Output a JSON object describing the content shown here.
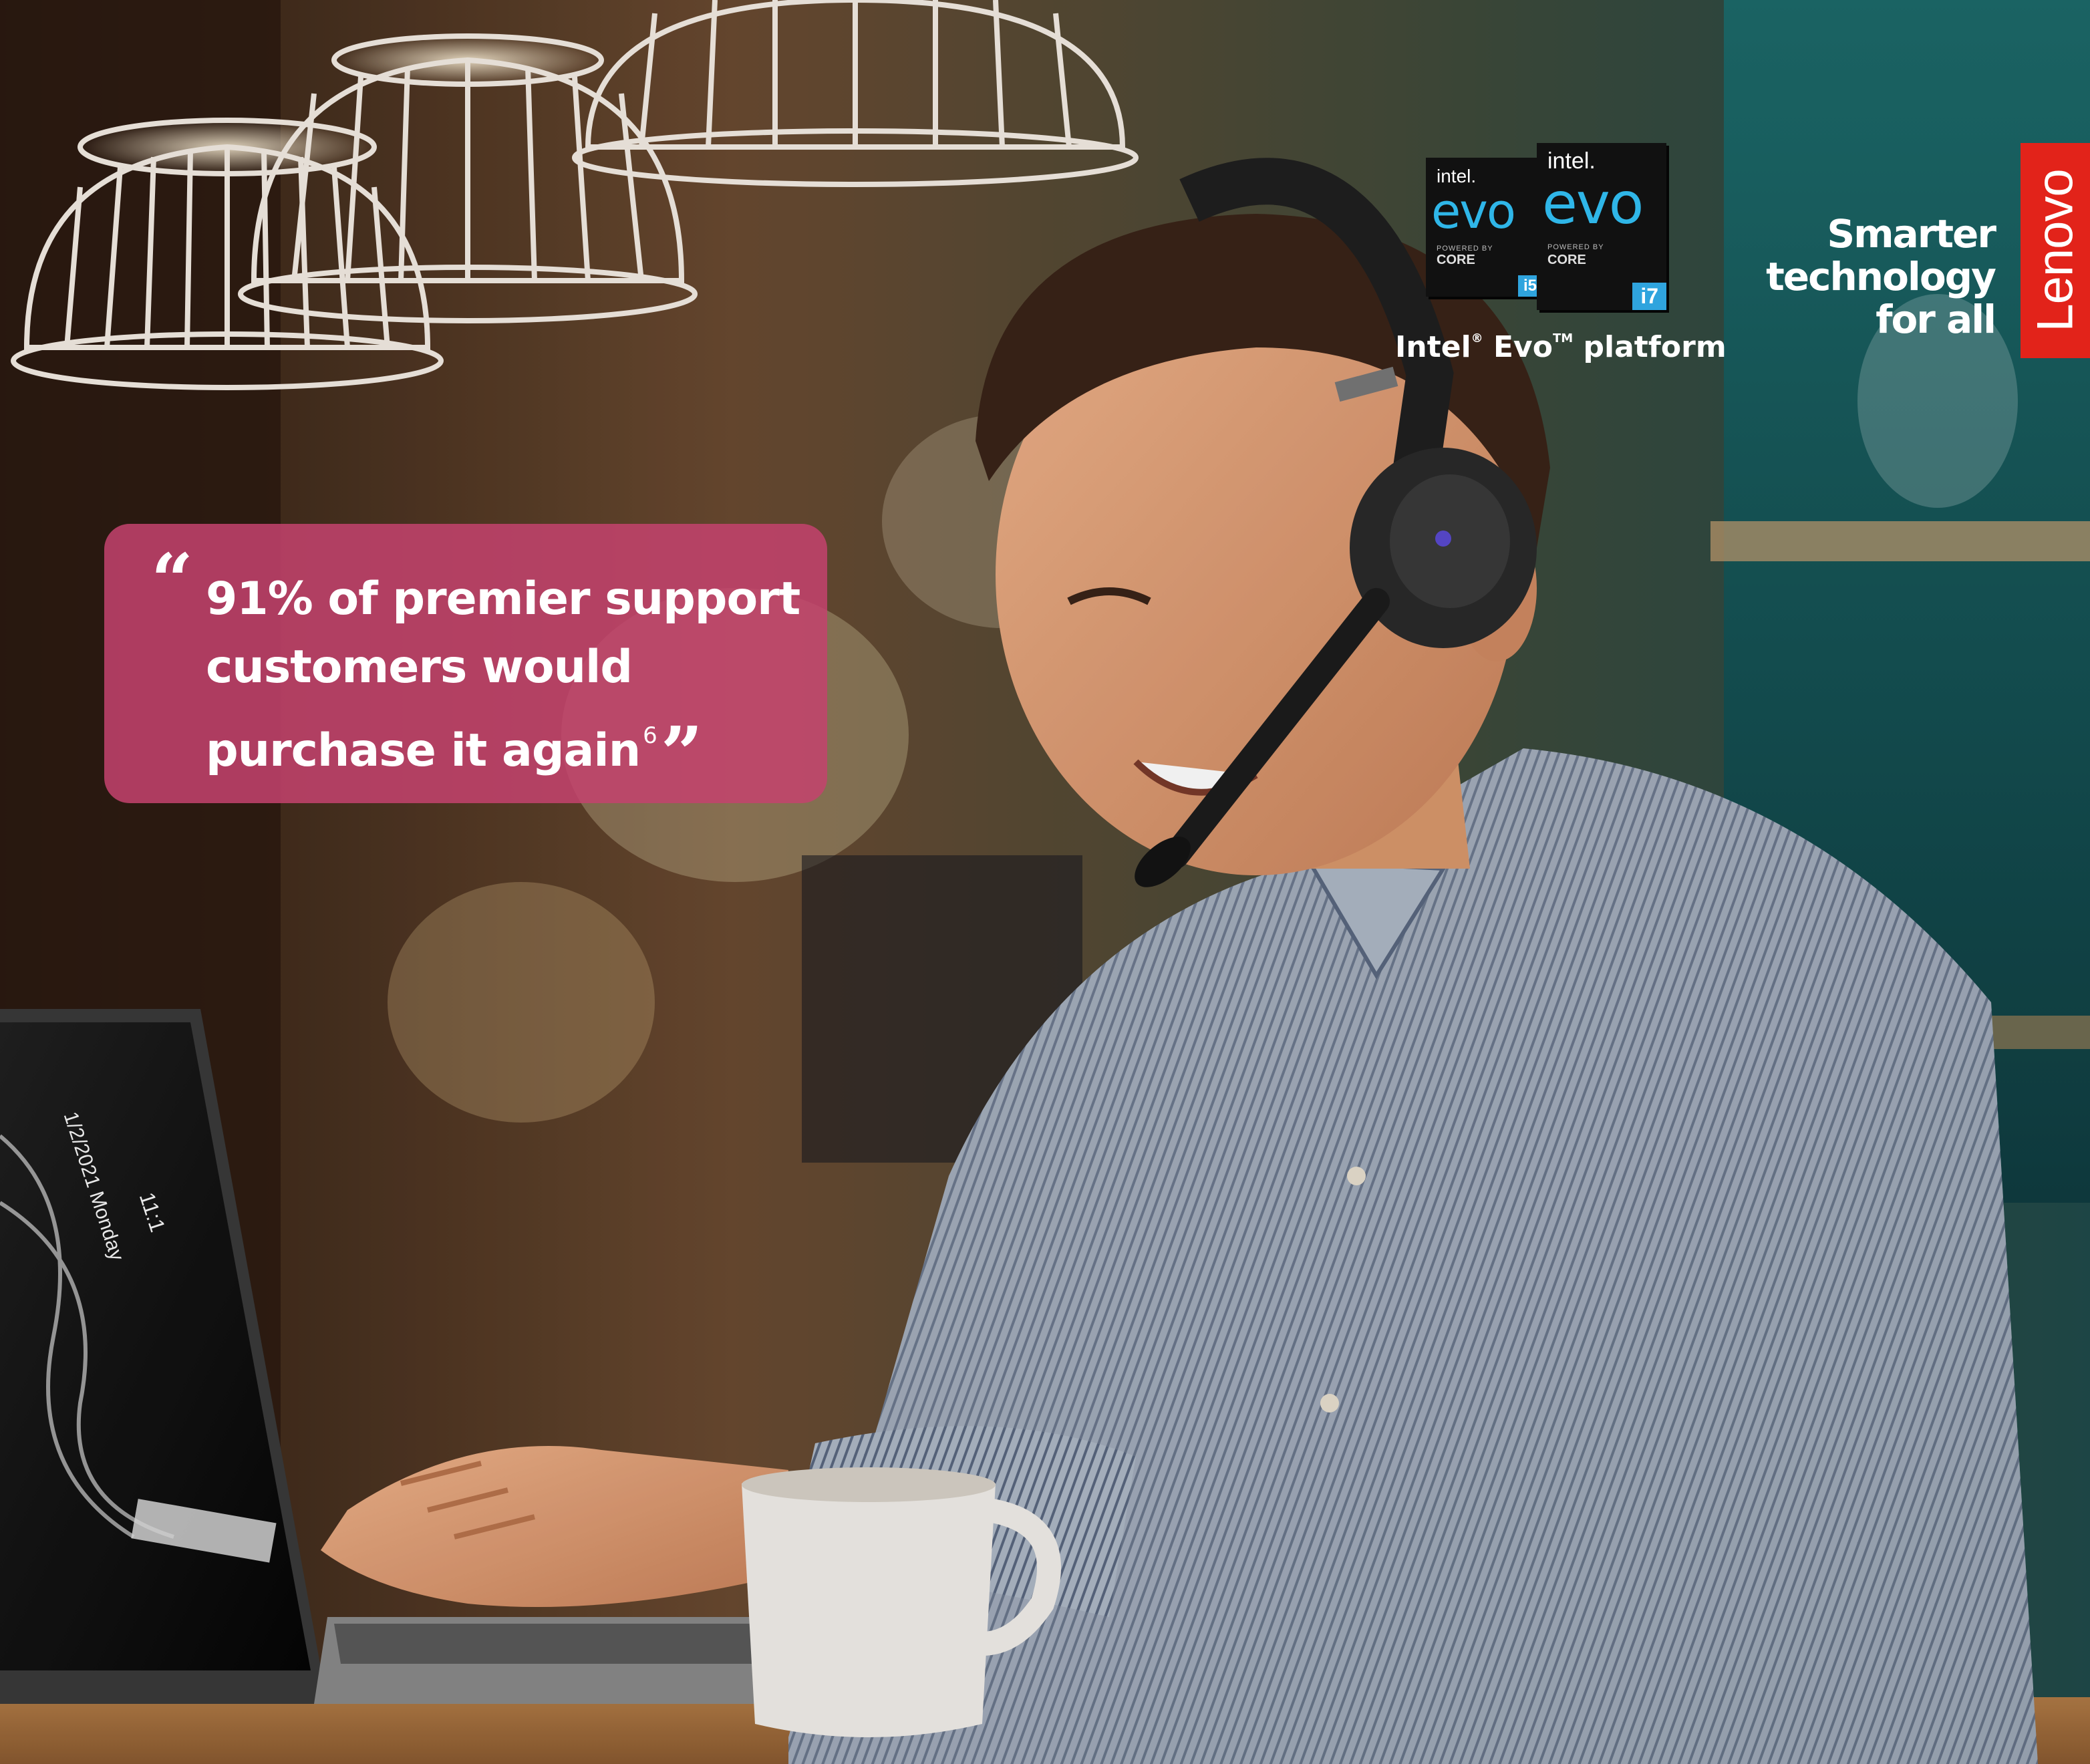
{
  "quote": {
    "open_mark": "“",
    "line1": "91% of premier support",
    "line2": "customers would",
    "line3": "purchase it again",
    "footnote": "6",
    "close_mark": "”"
  },
  "intel": {
    "brand": "intel.",
    "product": "evo",
    "powered_by": "POWERED BY",
    "core": "CORE",
    "tier_i5": "i5",
    "tier_i7": "i7",
    "caption_intel": "Intel",
    "caption_evo": "Evo",
    "caption_platform": "platform",
    "caption_reg": "®",
    "caption_tm": "TM"
  },
  "tagline": {
    "line1": "Smarter",
    "line2": "technology",
    "line3": "for all"
  },
  "logo": {
    "text": "Lenovo",
    "color": "#e2231a"
  },
  "laptop_screen": {
    "date": "1/2/2021 Monday",
    "time": "11:1"
  },
  "colors": {
    "quote_bg": "#c4426e",
    "evo_blue": "#2fb6e8",
    "tier_blue": "#2fa4de"
  }
}
